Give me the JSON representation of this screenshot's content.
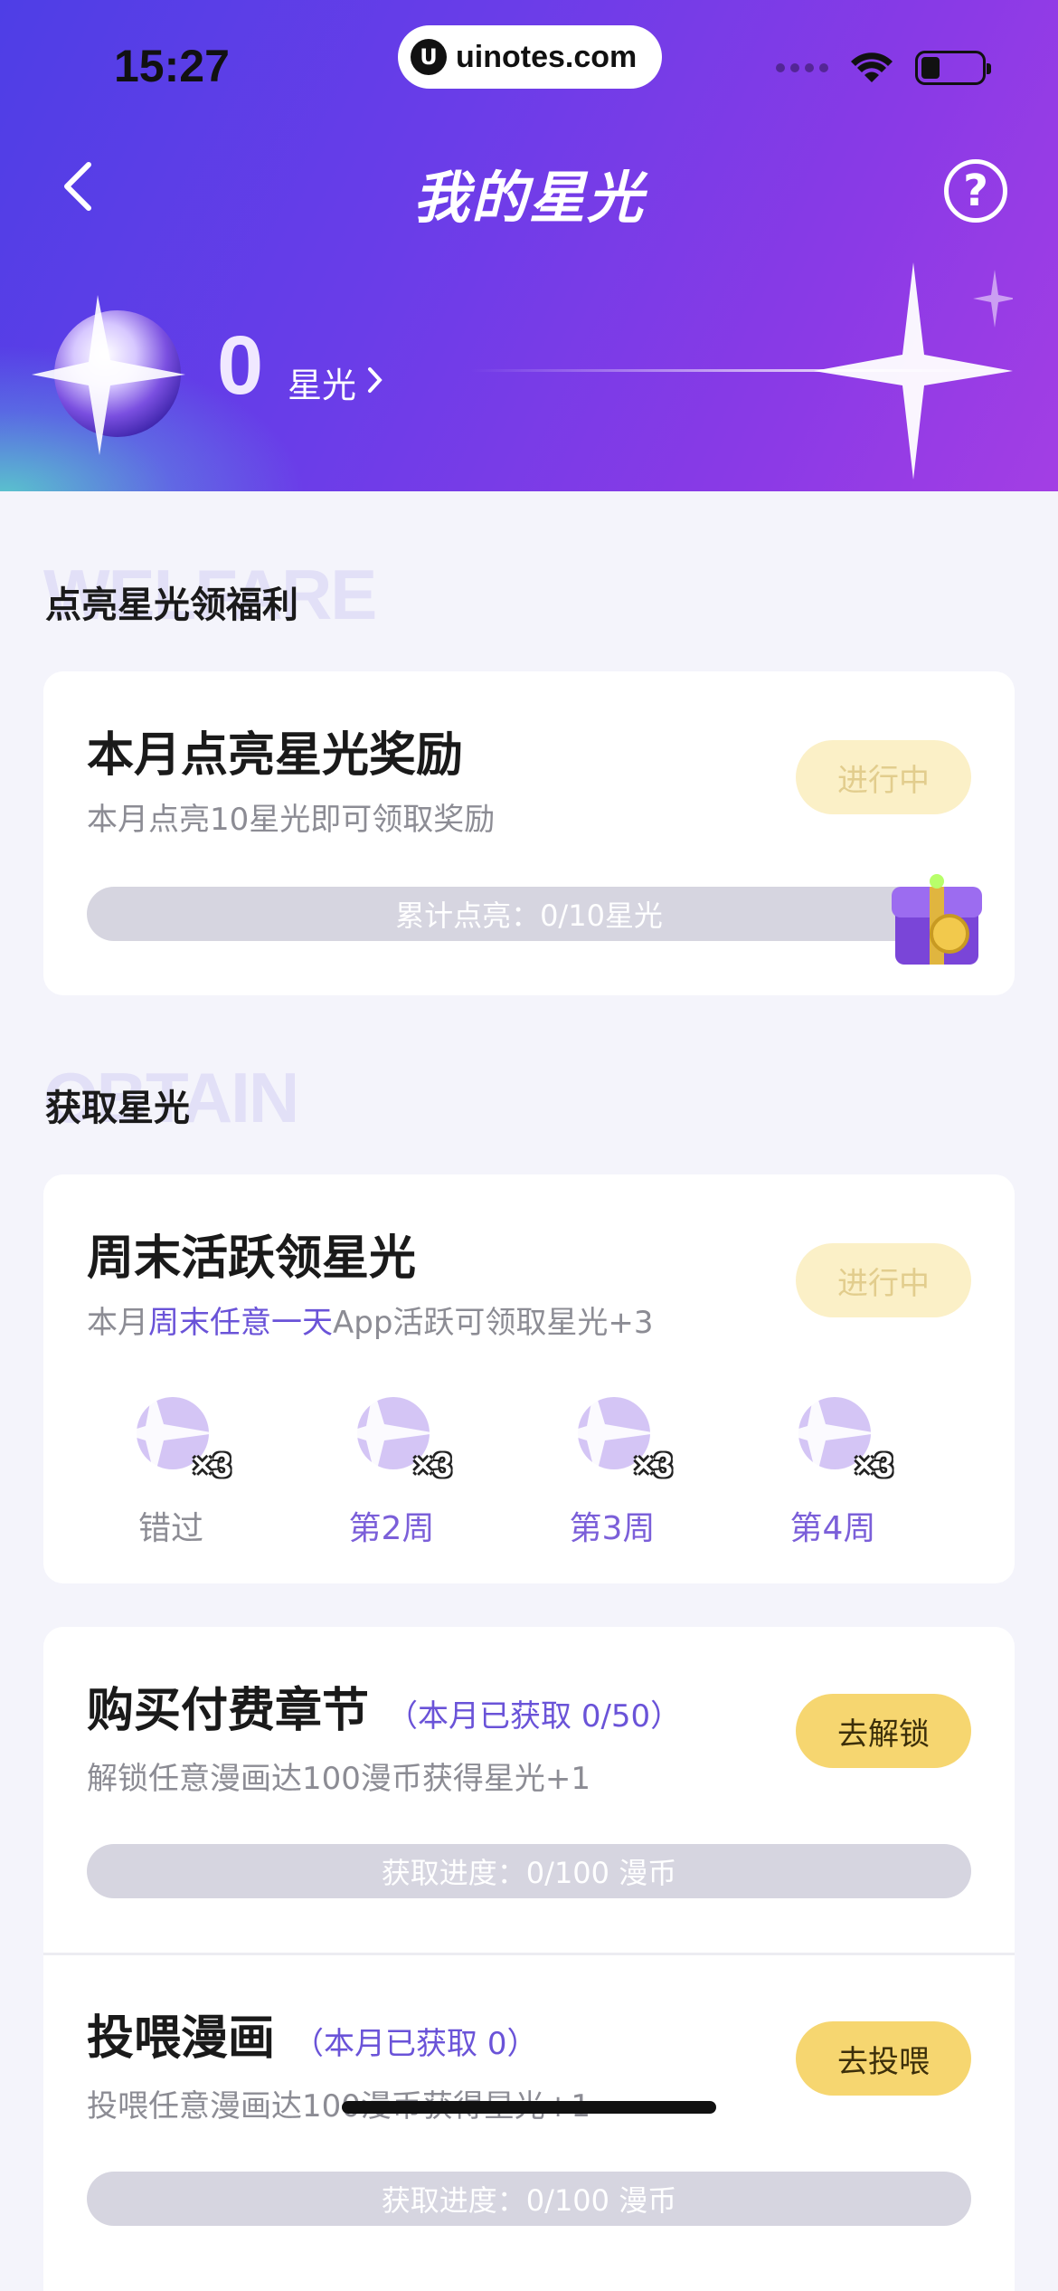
{
  "status_bar": {
    "time": "15:27",
    "url": "uinotes.com"
  },
  "header": {
    "title": "我的星光",
    "star_count": "0",
    "star_unit": "星光"
  },
  "welfare_section": {
    "watermark": "WELFARE",
    "title": "点亮星光领福利",
    "card": {
      "title": "本月点亮星光奖励",
      "subtitle": "本月点亮10星光即可领取奖励",
      "status": "进行中",
      "progress_text": "累计点亮：0/10星光",
      "progress_fraction": 0
    }
  },
  "obtain_section": {
    "watermark": "OBTAIN",
    "title": "获取星光",
    "weekend_card": {
      "title": "周末活跃领星光",
      "subtitle_pre": "本月",
      "subtitle_highlight": "周末任意一天",
      "subtitle_post": "App活跃可领取星光+3",
      "status": "进行中",
      "weeks": [
        {
          "label": "错过",
          "multiplier": "×3",
          "state": "missed"
        },
        {
          "label": "第2周",
          "multiplier": "×3",
          "state": "future"
        },
        {
          "label": "第3周",
          "multiplier": "×3",
          "state": "future"
        },
        {
          "label": "第4周",
          "multiplier": "×3",
          "state": "future"
        }
      ]
    },
    "tasks": [
      {
        "title": "购买付费章节",
        "count_note": "（本月已获取 0/50）",
        "subtitle": "解锁任意漫画达100漫币获得星光+1",
        "button": "去解锁",
        "progress_text": "获取进度：0/100 漫币",
        "progress_fraction": 0
      },
      {
        "title": "投喂漫画",
        "count_note": "（本月已获取 0）",
        "subtitle": "投喂任意漫画达100漫币获得星光+1",
        "button": "去投喂",
        "progress_text": "获取进度：0/100 漫币",
        "progress_fraction": 0
      }
    ]
  },
  "colors": {
    "header_gradient_start": "#4e3ee6",
    "header_gradient_end": "#a33ee4",
    "accent_purple": "#6a53d8",
    "action_yellow": "#f6d670",
    "pending_yellow": "#fbf0c7"
  }
}
